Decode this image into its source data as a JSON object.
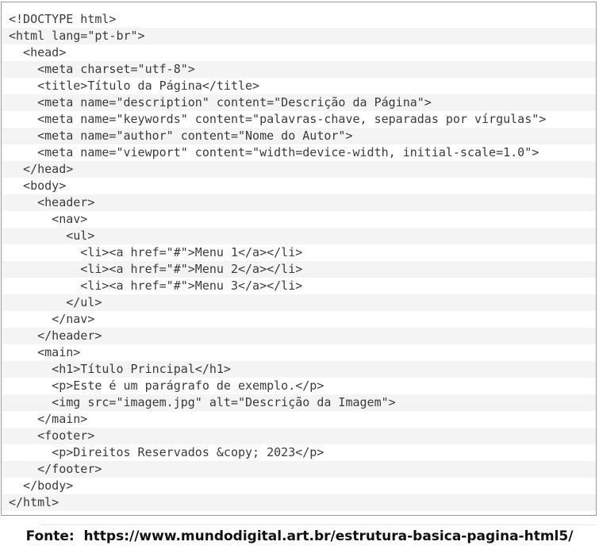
{
  "code_lines": [
    "<!DOCTYPE html>",
    "<html lang=\"pt-br\">",
    "  <head>",
    "    <meta charset=\"utf-8\">",
    "    <title>Título da Página</title>",
    "    <meta name=\"description\" content=\"Descrição da Página\">",
    "    <meta name=\"keywords\" content=\"palavras-chave, separadas por vírgulas\">",
    "    <meta name=\"author\" content=\"Nome do Autor\">",
    "    <meta name=\"viewport\" content=\"width=device-width, initial-scale=1.0\">",
    "  </head>",
    "  <body>",
    "    <header>",
    "      <nav>",
    "        <ul>",
    "          <li><a href=\"#\">Menu 1</a></li>",
    "          <li><a href=\"#\">Menu 2</a></li>",
    "          <li><a href=\"#\">Menu 3</a></li>",
    "        </ul>",
    "      </nav>",
    "    </header>",
    "    <main>",
    "      <h1>Título Principal</h1>",
    "      <p>Este é um parágrafo de exemplo.</p>",
    "      <img src=\"imagem.jpg\" alt=\"Descrição da Imagem\">",
    "    </main>",
    "    <footer>",
    "      <p>Direitos Reservados &copy; 2023</p>",
    "    </footer>",
    "  </body>",
    "</html>"
  ],
  "caption": "Fonte:  https://www.mundodigital.art.br/estrutura-basica-pagina-html5/"
}
